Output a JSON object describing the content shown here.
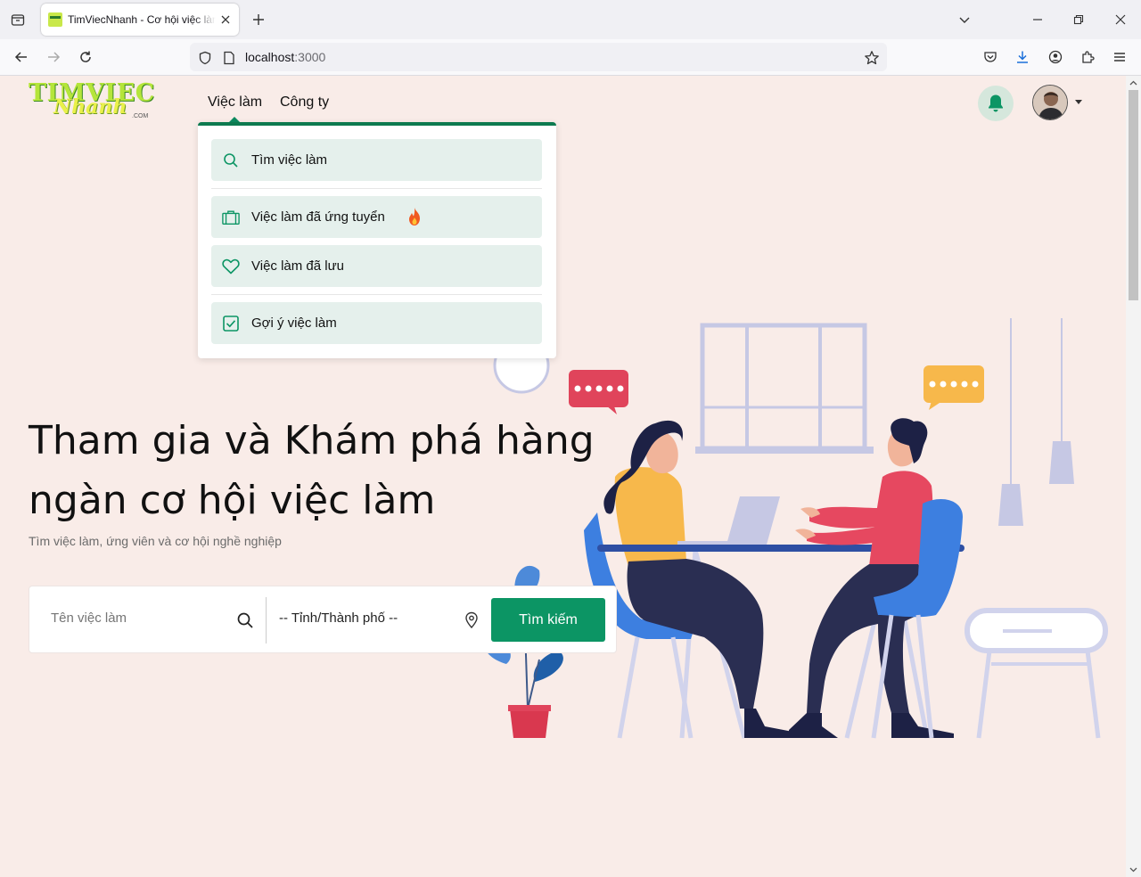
{
  "browser": {
    "tab_title": "TimViecNhanh - Cơ hội việc làm",
    "url_host": "localhost",
    "url_port": ":3000"
  },
  "header": {
    "logo_top": "TIMVIEC",
    "logo_script": "Nhanh",
    "logo_suffix": ".COM",
    "menu": [
      {
        "label": "Việc làm"
      },
      {
        "label": "Công ty"
      }
    ]
  },
  "dropdown": {
    "items": [
      {
        "label": "Tìm việc làm",
        "icon": "search-icon"
      },
      {
        "label": "Việc làm đã ứng tuyển",
        "icon": "briefcase-icon",
        "badge": "fire-icon"
      },
      {
        "label": "Việc làm đã lưu",
        "icon": "heart-icon"
      },
      {
        "label": "Gợi ý việc làm",
        "icon": "checkbox-icon"
      }
    ]
  },
  "hero": {
    "title": "Tham gia và Khám phá hàng ngàn cơ hội việc làm",
    "subtitle": "Tìm việc làm, ứng viên và cơ hội nghề nghiệp"
  },
  "search": {
    "job_placeholder": "Tên việc làm",
    "city_placeholder": "-- Tỉnh/Thành phố --",
    "button_label": "Tìm kiếm"
  },
  "colors": {
    "primary": "#0c9564",
    "dropdown_item_bg": "#e5f0ec",
    "page_bg": "#f9ece8"
  }
}
